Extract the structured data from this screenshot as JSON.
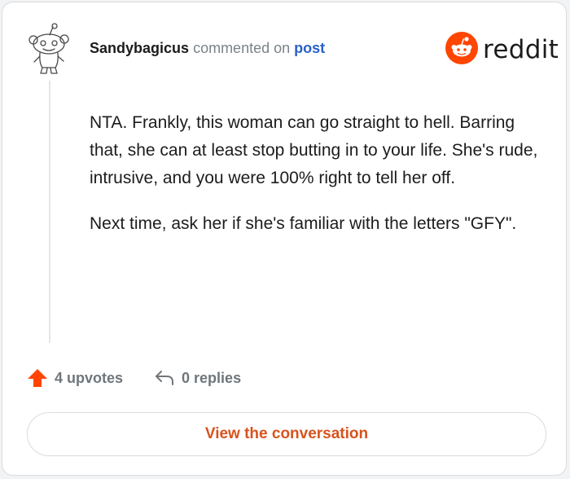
{
  "comment": {
    "author": "Sandybagicus",
    "action_text": "commented on",
    "target_link": "post",
    "paragraphs": [
      "NTA. Frankly, this woman can go straight to hell. Barring that, she can at least stop butting in to your life. She's rude, intrusive, and you were 100% right to tell her off.",
      "Next time, ask her if she's familiar with the letters \"GFY\"."
    ]
  },
  "brand": {
    "wordmark": "reddit",
    "accent_color": "#ff4500"
  },
  "actions": {
    "upvotes_label": "4 upvotes",
    "replies_label": "0 replies",
    "upvote_color": "#ff4500"
  },
  "cta": {
    "label": "View the conversation",
    "color": "#d7531d"
  },
  "icons": {
    "avatar": "snoo-avatar-icon",
    "logo": "reddit-alien-icon",
    "upvote": "upvote-arrow-icon",
    "reply": "reply-arrow-icon"
  }
}
